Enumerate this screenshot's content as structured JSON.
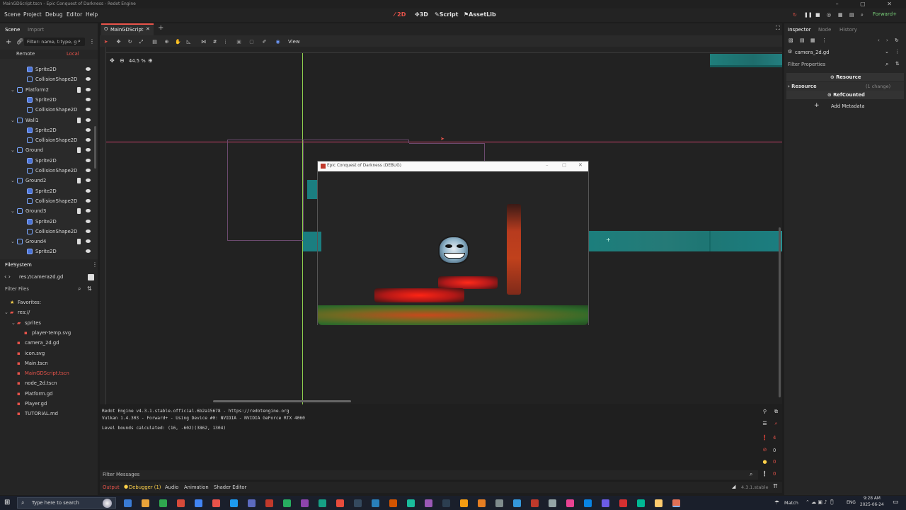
{
  "window": {
    "title": "MainGDScript.tscn - Epic Conquest of Darkness - Redot Engine",
    "controls": "–  ▢  ✕"
  },
  "menu": [
    "Scene",
    "Project",
    "Debug",
    "Editor",
    "Help"
  ],
  "workspaces": [
    {
      "label": "2D",
      "active": true
    },
    {
      "label": "3D",
      "active": false
    },
    {
      "label": "Script",
      "active": false
    },
    {
      "label": "AssetLib",
      "active": false
    }
  ],
  "renderer": "Forward+",
  "scene_panel": {
    "tabs": [
      "Scene",
      "Import"
    ],
    "filter_placeholder": "Filter: name, t:type, g:group",
    "remote_label": "Remote",
    "local_label": "Local",
    "tree": [
      {
        "label": "Sprite2D",
        "indent": 2,
        "icon": "sprite",
        "script": false
      },
      {
        "label": "CollisionShape2D",
        "indent": 2,
        "icon": "collision",
        "script": false
      },
      {
        "label": "Platform2",
        "indent": 1,
        "icon": "node",
        "script": true
      },
      {
        "label": "Sprite2D",
        "indent": 2,
        "icon": "sprite",
        "script": false
      },
      {
        "label": "CollisionShape2D",
        "indent": 2,
        "icon": "collision",
        "script": false
      },
      {
        "label": "Wall1",
        "indent": 1,
        "icon": "node",
        "script": true
      },
      {
        "label": "Sprite2D",
        "indent": 2,
        "icon": "sprite",
        "script": false
      },
      {
        "label": "CollisionShape2D",
        "indent": 2,
        "icon": "collision",
        "script": false
      },
      {
        "label": "Ground",
        "indent": 1,
        "icon": "node",
        "script": true
      },
      {
        "label": "Sprite2D",
        "indent": 2,
        "icon": "sprite",
        "script": false
      },
      {
        "label": "CollisionShape2D",
        "indent": 2,
        "icon": "collision",
        "script": false
      },
      {
        "label": "Ground2",
        "indent": 1,
        "icon": "node",
        "script": true
      },
      {
        "label": "Sprite2D",
        "indent": 2,
        "icon": "sprite",
        "script": false
      },
      {
        "label": "CollisionShape2D",
        "indent": 2,
        "icon": "collision",
        "script": false
      },
      {
        "label": "Ground3",
        "indent": 1,
        "icon": "node",
        "script": true
      },
      {
        "label": "Sprite2D",
        "indent": 2,
        "icon": "sprite",
        "script": false
      },
      {
        "label": "CollisionShape2D",
        "indent": 2,
        "icon": "collision",
        "script": false
      },
      {
        "label": "Ground4",
        "indent": 1,
        "icon": "node",
        "script": true
      },
      {
        "label": "Sprite2D",
        "indent": 2,
        "icon": "sprite",
        "script": false
      }
    ]
  },
  "filesystem": {
    "title": "FileSystem",
    "path": "res://camera2d.gd",
    "filter_placeholder": "Filter Files",
    "items": [
      {
        "label": "Favorites:",
        "indent": 0,
        "color": "#d6d6d6"
      },
      {
        "label": "res://",
        "indent": 0,
        "color": "#d6d6d6"
      },
      {
        "label": "sprites",
        "indent": 1,
        "color": "#d6d6d6"
      },
      {
        "label": "player-temp.svg",
        "indent": 2,
        "color": "#d6d6d6"
      },
      {
        "label": "camera_2d.gd",
        "indent": 1,
        "color": "#d6d6d6"
      },
      {
        "label": "icon.svg",
        "indent": 1,
        "color": "#d6d6d6"
      },
      {
        "label": "Main.tscn",
        "indent": 1,
        "color": "#d6d6d6"
      },
      {
        "label": "MainGDScript.tscn",
        "indent": 1,
        "color": "#e8534a"
      },
      {
        "label": "node_2d.tscn",
        "indent": 1,
        "color": "#d6d6d6"
      },
      {
        "label": "Platform.gd",
        "indent": 1,
        "color": "#d6d6d6"
      },
      {
        "label": "Player.gd",
        "indent": 1,
        "color": "#d6d6d6"
      },
      {
        "label": "TUTORIAL.md",
        "indent": 1,
        "color": "#d6d6d6"
      }
    ]
  },
  "editor_tab": {
    "label": "MainGDScript"
  },
  "toolbar": {
    "view_label": "View",
    "zoom": "44.5 %"
  },
  "game_window": {
    "title": "Epic Conquest of Darkness (DEBUG)"
  },
  "inspector": {
    "tabs": [
      "Inspector",
      "Node",
      "History"
    ],
    "object": "camera_2d.gd",
    "filter_placeholder": "Filter Properties",
    "section": "Resource",
    "resource_label": "Resource",
    "resource_changes": "(1 change)",
    "refcounted": "RefCounted",
    "add_metadata": "Add Metadata"
  },
  "output": {
    "lines": [
      "Redot Engine v4.3.1.stable.official.6b2a15678 - https://redotengine.org",
      "Vulkan 1.4.303 - Forward+ - Using Device #0: NVIDIA - NVIDIA GeForce RTX 4060",
      "",
      "Level bounds calculated: (16, -602)(3862, 1304)"
    ],
    "filter_placeholder": "Filter Messages",
    "counts": {
      "errors": "0",
      "warnings": "0",
      "messages": "0"
    }
  },
  "bottom_tabs": [
    {
      "label": "Output",
      "color": "#e8534a"
    },
    {
      "label": "Debugger (1)",
      "color": "#ffd24a"
    },
    {
      "label": "Audio",
      "color": "#d6d6d6"
    },
    {
      "label": "Animation",
      "color": "#d6d6d6"
    },
    {
      "label": "Shader Editor",
      "color": "#d6d6d6"
    }
  ],
  "version": "4.3.1.stable",
  "taskbar": {
    "search_placeholder": "Type here to search",
    "weather": "Match",
    "tray": "ENG",
    "time": "9:28 AM",
    "date": "2025-06-24"
  }
}
